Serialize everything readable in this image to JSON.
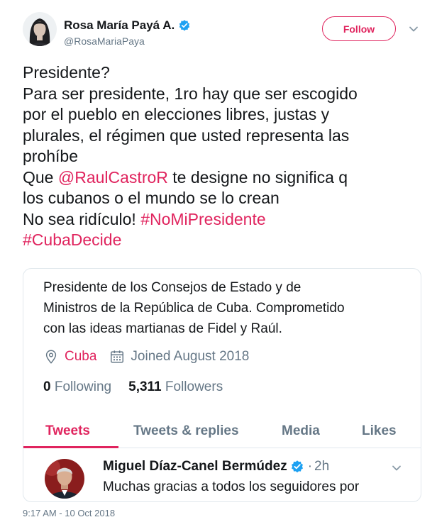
{
  "author": {
    "display_name": "Rosa María Payá A.",
    "handle": "@RosaMariaPaya",
    "verified": true
  },
  "follow_button": {
    "label": "Follow"
  },
  "tweet": {
    "lines": [
      [
        {
          "text": "Presidente?"
        }
      ],
      [
        {
          "text": "Para ser presidente, 1ro hay que ser escogido"
        }
      ],
      [
        {
          "text": "por el pueblo en elecciones libres, justas y"
        }
      ],
      [
        {
          "text": "plurales, el régimen que usted representa las"
        }
      ],
      [
        {
          "text": "prohíbe"
        }
      ],
      [
        {
          "text": "Que "
        },
        {
          "text": "@RaulCastroR",
          "link": true
        },
        {
          "text": " te designe no significa q"
        }
      ],
      [
        {
          "text": "los cubanos o el mundo se lo crean"
        }
      ],
      [
        {
          "text": "No sea ridículo! "
        },
        {
          "text": "#NoMiPresidente",
          "link": true
        }
      ],
      [
        {
          "text": "#CubaDecide",
          "link": true
        }
      ]
    ]
  },
  "card": {
    "bio_lines": [
      "Presidente de los Consejos de Estado y de",
      "Ministros de la República de Cuba. Comprometido",
      "con las ideas martianas de Fidel y Raúl."
    ],
    "location": "Cuba",
    "joined": "Joined August 2018",
    "following_count": "0",
    "following_label": "Following",
    "followers_count": "5,311",
    "followers_label": "Followers",
    "tabs": [
      "Tweets",
      "Tweets & replies",
      "Media",
      "Likes"
    ],
    "active_tab": 0,
    "inner_tweet": {
      "name": "Miguel Díaz-Canel Bermúdez",
      "verified": true,
      "dot": "·",
      "time": "2h",
      "text": "Muchas gracias a todos los seguidores por"
    }
  },
  "timestamp": "9:17 AM - 10 Oct 2018",
  "colors": {
    "accent": "#e0245e",
    "verified_badge": "#1da1f2",
    "secondary_text": "#657786",
    "border": "#e1e8ed"
  }
}
